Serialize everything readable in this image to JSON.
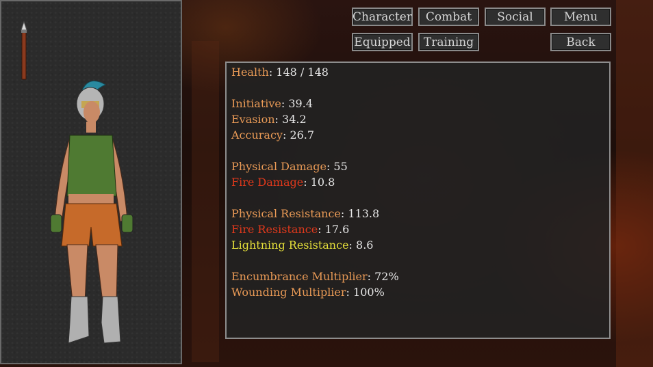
{
  "nav": {
    "character_label": "Character",
    "combat_label": "Combat",
    "social_label": "Social",
    "menu_label": "Menu",
    "equipped_label": "Equipped",
    "training_label": "Training",
    "back_label": "Back"
  },
  "stats": {
    "health_label": "Health",
    "health_value": ": 148 / 148",
    "initiative_label": "Initiative",
    "initiative_value": ": 39.4",
    "evasion_label": "Evasion",
    "evasion_value": ": 34.2",
    "accuracy_label": "Accuracy",
    "accuracy_value": ": 26.7",
    "physical_damage_label": "Physical Damage",
    "physical_damage_value": ": 55",
    "fire_damage_label": "Fire Damage",
    "fire_damage_value": ": 10.8",
    "physical_resistance_label": "Physical Resistance",
    "physical_resistance_value": ": 113.8",
    "fire_resistance_label": "Fire Resistance",
    "fire_resistance_value": ": 17.6",
    "lightning_resistance_label": "Lightning Resistance",
    "lightning_resistance_value": ": 8.6",
    "encumbrance_label": "Encumbrance Multiplier",
    "encumbrance_value": ": 72%",
    "wounding_label": "Wounding Multiplier",
    "wounding_value": ": 100%"
  },
  "colors": {
    "label_orange": "#e99a56",
    "fire_red": "#e0391c",
    "lightning_yellow": "#e5df3a",
    "value_white": "#e6e6e6"
  },
  "icons": {
    "equipped_weapon": "spear-icon"
  }
}
